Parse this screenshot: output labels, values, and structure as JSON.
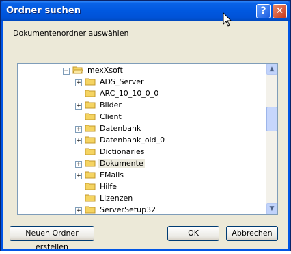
{
  "window": {
    "title": "Ordner suchen"
  },
  "title_buttons": {
    "help": "?",
    "close": "✕"
  },
  "dialog": {
    "subtitle": "Dokumentenordner auswählen"
  },
  "tree": {
    "root": {
      "label": "mexXsoft",
      "expander": "−"
    },
    "items": [
      {
        "label": "ADS_Server",
        "expander": "+"
      },
      {
        "label": "ARC_10_10_0_0",
        "expander": ""
      },
      {
        "label": "Bilder",
        "expander": "+"
      },
      {
        "label": "Client",
        "expander": ""
      },
      {
        "label": "Datenbank",
        "expander": "+"
      },
      {
        "label": "Datenbank_old_0",
        "expander": "+"
      },
      {
        "label": "Dictionaries",
        "expander": ""
      },
      {
        "label": "Dokumente",
        "expander": "+",
        "selected": true
      },
      {
        "label": "EMails",
        "expander": "+"
      },
      {
        "label": "Hilfe",
        "expander": ""
      },
      {
        "label": "Lizenzen",
        "expander": ""
      },
      {
        "label": "ServerSetup32",
        "expander": "+"
      }
    ]
  },
  "scrollbar": {
    "up": "▲",
    "down": "▼"
  },
  "buttons": {
    "new_folder": "Neuen Ordner erstellen",
    "ok": "OK",
    "cancel": "Abbrechen"
  },
  "colors": {
    "titlebar": "#0058e0",
    "client": "#ece9d8",
    "folder": "#f5d462"
  }
}
